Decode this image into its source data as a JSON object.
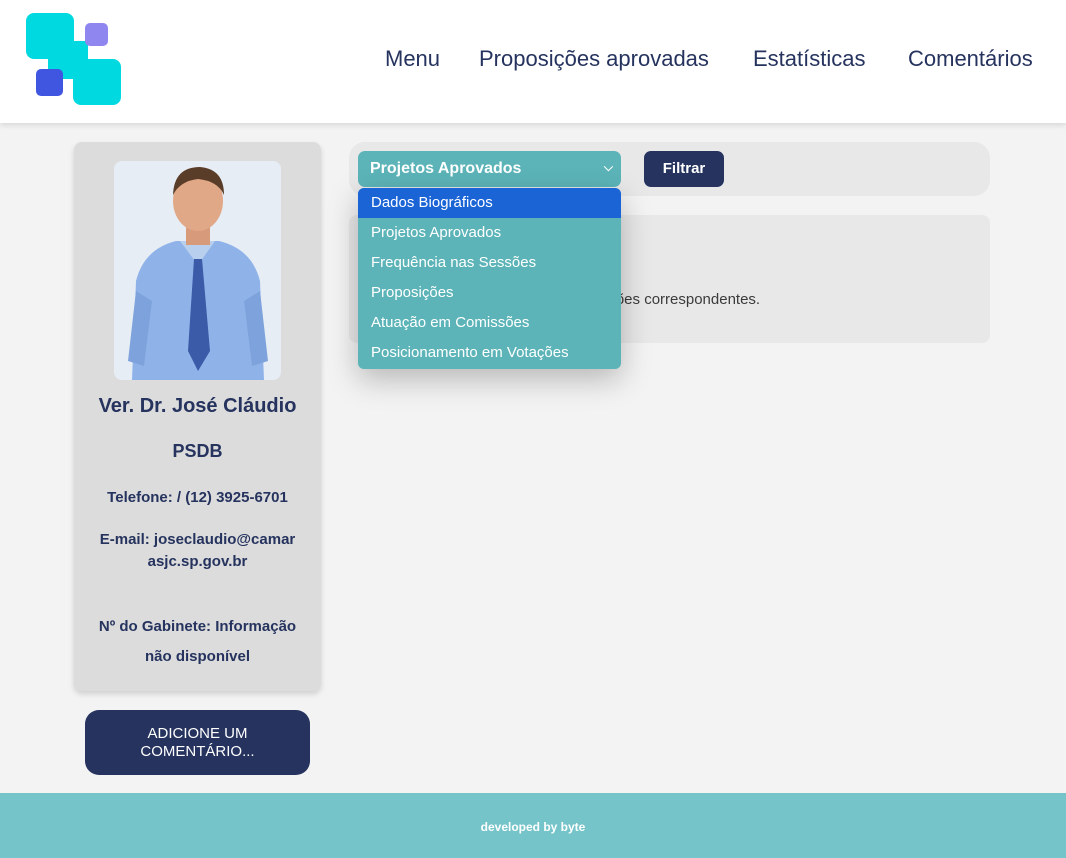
{
  "nav": {
    "menu": "Menu",
    "proposicoes": "Proposições aprovadas",
    "estatisticas": "Estatísticas",
    "comentarios": "Comentários"
  },
  "profile": {
    "name": "Ver. Dr. José Cláudio",
    "party": "PSDB",
    "phone": "Telefone: / (12) 3925-6701",
    "email": "E-mail: joseclaudio@camarasjc.sp.gov.br",
    "office": "Nº do Gabinete: Informação não disponível"
  },
  "comment_button": "ADICIONE UM COMENTÁRIO...",
  "filter": {
    "selected": "Projetos Aprovados",
    "button": "Filtrar",
    "options": [
      "Dados Biográficos",
      "Projetos Aprovados",
      "Frequência nas Sessões",
      "Proposições",
      "Atuação em Comissões",
      "Posicionamento em Votações"
    ],
    "highlighted": "Dados Biográficos"
  },
  "content": {
    "partial_text": "ações correspondentes."
  },
  "footer": "developed by byte",
  "colors": {
    "navy": "#25335e",
    "teal": "#5cb4b8",
    "footer": "#75c4c9",
    "highlight": "#1a64d6",
    "logo_cyan": "#00d9e0",
    "logo_blue": "#4055e0",
    "logo_lilac": "#8f86f0"
  }
}
